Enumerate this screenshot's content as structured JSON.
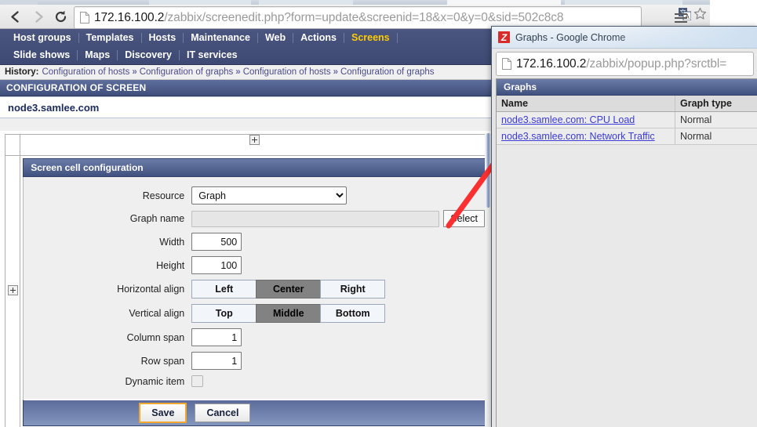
{
  "browser": {
    "back_icon": "back-arrow-icon",
    "forward_icon": "forward-arrow-icon",
    "reload_icon": "reload-icon",
    "page_icon": "page-document-icon",
    "url_host": "172.16.100.2",
    "url_path": "/zabbix/screenedit.php?form=update&screenid=18&x=0&y=0&sid=502c8c8",
    "translate_icon": "translate-icon",
    "bookmark_icon": "star-icon",
    "menu_icon": "hamburger-menu-icon"
  },
  "zabbix": {
    "menu_row1": [
      {
        "label": "Host groups",
        "selected": false
      },
      {
        "label": "Templates",
        "selected": false
      },
      {
        "label": "Hosts",
        "selected": false
      },
      {
        "label": "Maintenance",
        "selected": false
      },
      {
        "label": "Web",
        "selected": false
      },
      {
        "label": "Actions",
        "selected": false
      },
      {
        "label": "Screens",
        "selected": true
      }
    ],
    "menu_row2": [
      {
        "label": "Slide shows",
        "selected": false
      },
      {
        "label": "Maps",
        "selected": false
      },
      {
        "label": "Discovery",
        "selected": false
      },
      {
        "label": "IT services",
        "selected": false
      }
    ],
    "history": {
      "label": "History:",
      "items": [
        "Configuration of hosts",
        "Configuration of graphs",
        "Configuration of hosts",
        "Configuration of graphs"
      ],
      "separator": "»"
    },
    "page_title": "CONFIGURATION OF SCREEN",
    "node_name": "node3.samlee.com",
    "add_cell_icon": "plus-square-icon"
  },
  "form": {
    "title": "Screen cell configuration",
    "fields": {
      "resource_label": "Resource",
      "resource_value": "Graph",
      "resource_options": [
        "Graph"
      ],
      "graph_name_label": "Graph name",
      "graph_name_value": "",
      "select_button": "Select",
      "width_label": "Width",
      "width_value": "500",
      "height_label": "Height",
      "height_value": "100",
      "halign_label": "Horizontal align",
      "halign_options": [
        "Left",
        "Center",
        "Right"
      ],
      "halign_selected": "Center",
      "valign_label": "Vertical align",
      "valign_options": [
        "Top",
        "Middle",
        "Bottom"
      ],
      "valign_selected": "Middle",
      "colspan_label": "Column span",
      "colspan_value": "1",
      "rowspan_label": "Row span",
      "rowspan_value": "1",
      "dynamic_label": "Dynamic item",
      "dynamic_checked": false
    },
    "save_button": "Save",
    "cancel_button": "Cancel"
  },
  "popup": {
    "logo_icon": "zabbix-logo-icon",
    "window_title": "Graphs - Google Chrome",
    "page_icon": "page-document-icon",
    "url_host": "172.16.100.2",
    "url_path": "/zabbix/popup.php?srctbl=",
    "section_title": "Graphs",
    "table": {
      "headers": [
        "Name",
        "Graph type"
      ],
      "rows": [
        {
          "name": "node3.samlee.com: CPU Load",
          "type": "Normal"
        },
        {
          "name": "node3.samlee.com: Network Traffic",
          "type": "Normal"
        }
      ]
    }
  },
  "annotation": {
    "arrow_color": "#fc3030",
    "arrow_name": "red-pointer-arrow"
  }
}
